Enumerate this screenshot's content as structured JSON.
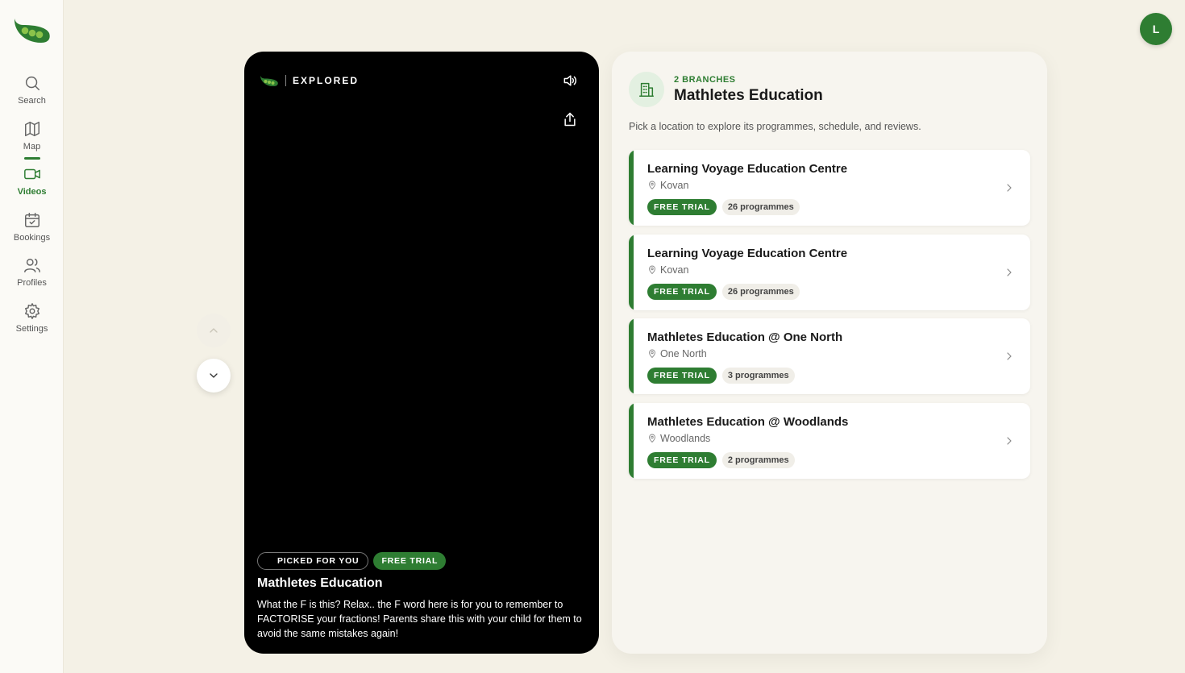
{
  "sidebar": {
    "items": [
      {
        "label": "Search",
        "icon": "search-icon"
      },
      {
        "label": "Map",
        "icon": "map-icon"
      },
      {
        "label": "Videos",
        "icon": "video-icon",
        "active": true
      },
      {
        "label": "Bookings",
        "icon": "calendar-icon"
      },
      {
        "label": "Profiles",
        "icon": "users-icon"
      },
      {
        "label": "Settings",
        "icon": "gear-icon"
      }
    ]
  },
  "user": {
    "initial": "L"
  },
  "video": {
    "brand": "EXPLORED",
    "tags": [
      "PICKED FOR YOU",
      "FREE TRIAL"
    ],
    "title": "Mathletes Education",
    "description": "What the F is this? Relax.. the F word here is for you to remember to FACTORISE your fractions! Parents share this with your child for them to avoid the same mistakes again!"
  },
  "panel": {
    "branch_count": "2 BRANCHES",
    "title": "Mathletes Education",
    "subtitle": "Pick a location to explore its programmes, schedule, and reviews.",
    "branches": [
      {
        "name": "Learning Voyage Education Centre",
        "location": "Kovan",
        "trial": "FREE TRIAL",
        "programmes": "26 programmes"
      },
      {
        "name": "Learning Voyage Education Centre",
        "location": "Kovan",
        "trial": "FREE TRIAL",
        "programmes": "26 programmes"
      },
      {
        "name": "Mathletes Education @ One North",
        "location": "One North",
        "trial": "FREE TRIAL",
        "programmes": "3 programmes"
      },
      {
        "name": "Mathletes Education @ Woodlands",
        "location": "Woodlands",
        "trial": "FREE TRIAL",
        "programmes": "2 programmes"
      }
    ]
  },
  "colors": {
    "accent": "#2e7d32",
    "background": "#f4f1e6",
    "video_bg": "#000000"
  }
}
